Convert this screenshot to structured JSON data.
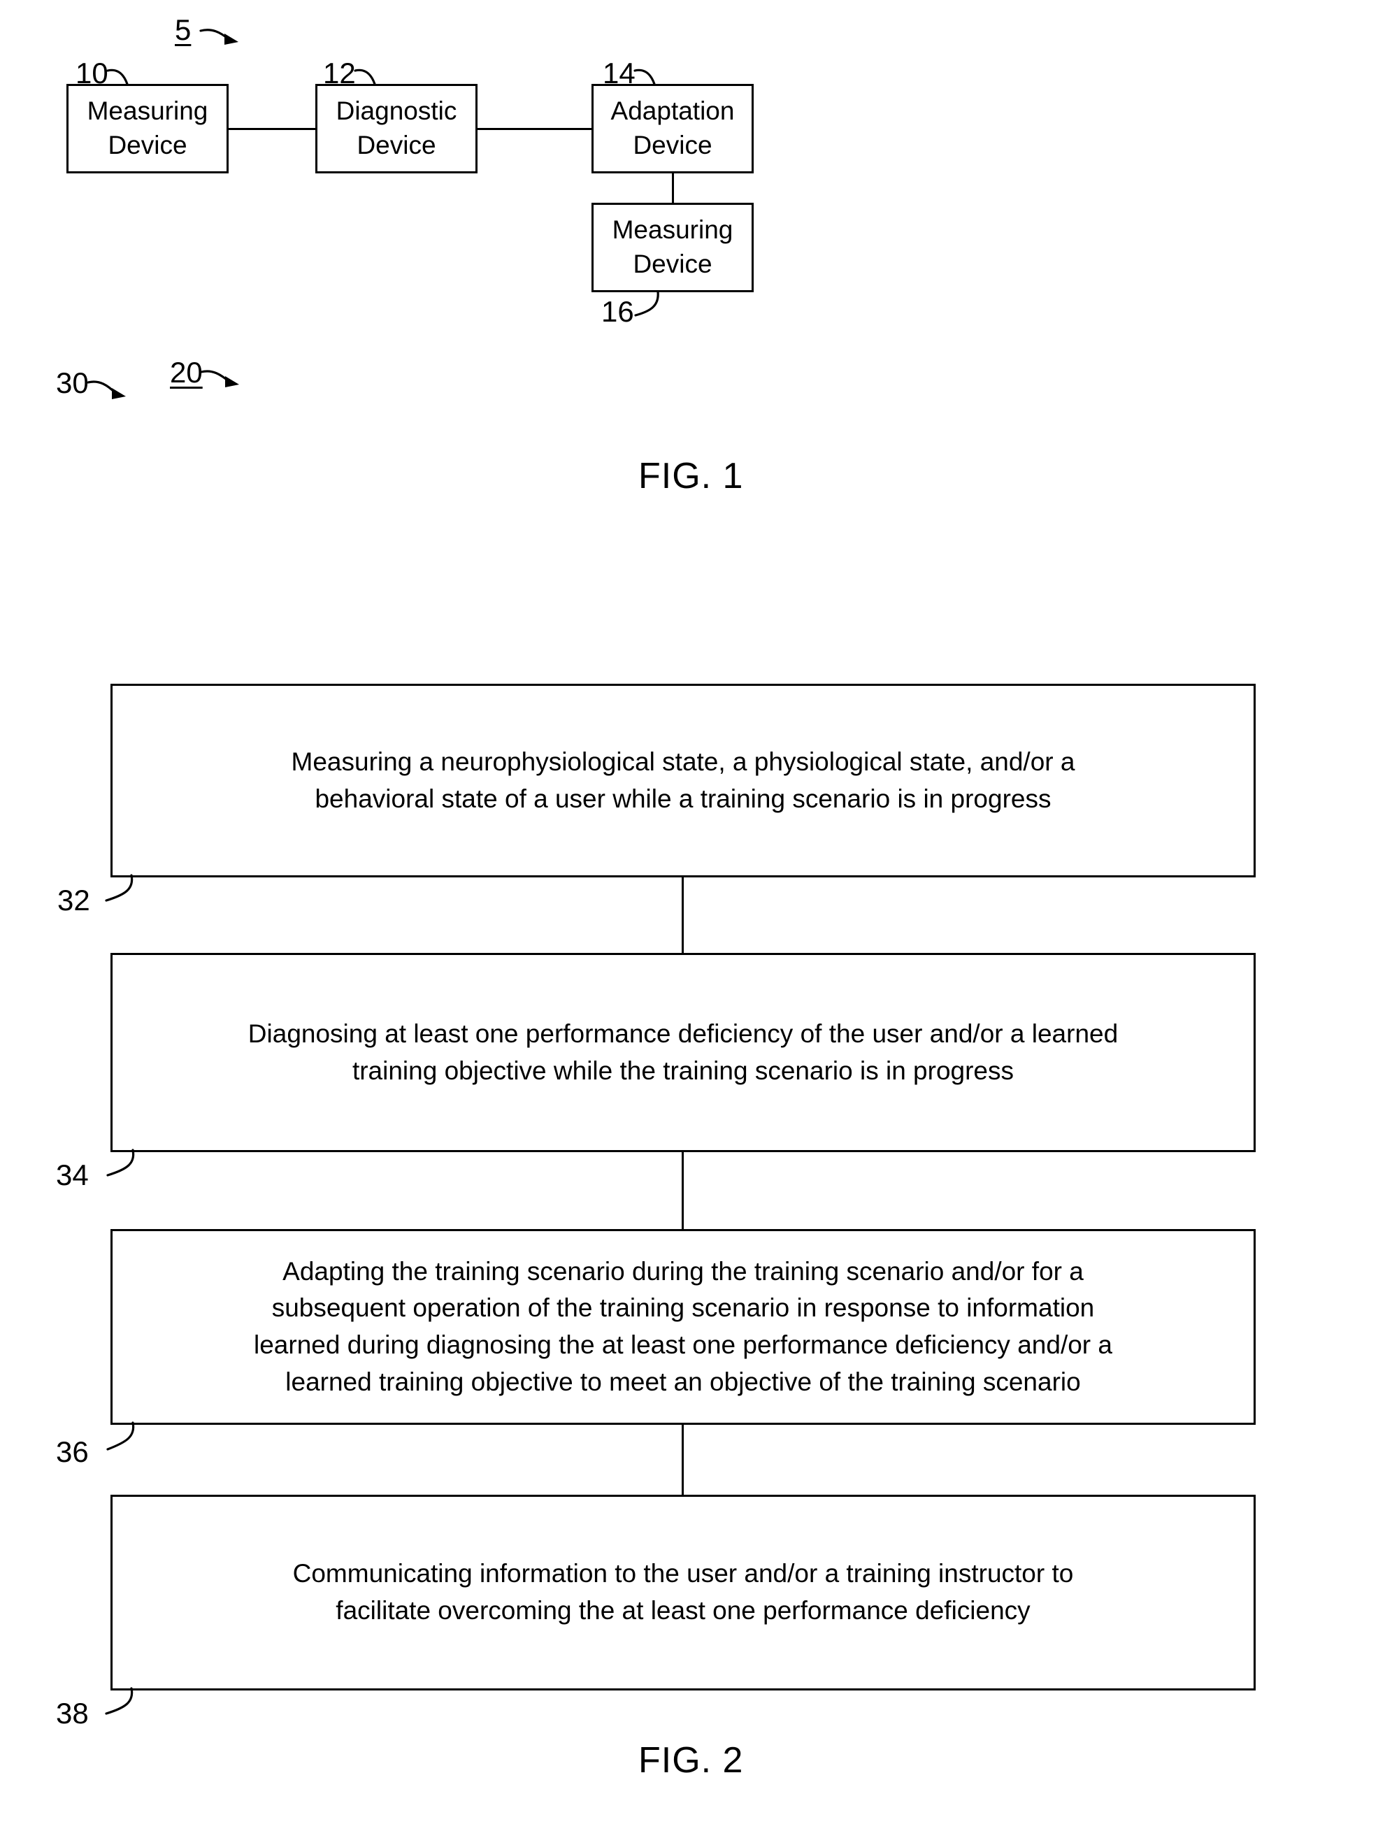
{
  "document": {
    "type": "patent-drawing-sheet",
    "background_color": "#ffffff",
    "ink_color": "#000000"
  },
  "figure1": {
    "caption": "FIG. 1",
    "system_ref": "5",
    "blocks": [
      {
        "ref": "10",
        "line1": "Measuring",
        "line2": "Device"
      },
      {
        "ref": "12",
        "line1": "Diagnostic",
        "line2": "Device"
      },
      {
        "ref": "14",
        "line1": "Adaptation",
        "line2": "Device"
      },
      {
        "ref": "16",
        "line1": "Measuring",
        "line2": "Device"
      }
    ]
  },
  "figure2": {
    "caption": "FIG. 2",
    "method_ref": "20",
    "flow_ref": "30",
    "steps": [
      {
        "ref": "32",
        "lines": [
          "Measuring a neurophysiological state, a physiological state, and/or a",
          "behavioral state of a user while a training scenario is in progress"
        ]
      },
      {
        "ref": "34",
        "lines": [
          "Diagnosing at least one performance deficiency of the user and/or a learned",
          "training objective while the training scenario is in progress"
        ]
      },
      {
        "ref": "36",
        "lines": [
          "Adapting the training scenario during the training scenario and/or for a",
          "subsequent operation of the training scenario in response to information",
          "learned during diagnosing the at least one performance deficiency and/or a",
          "learned training objective to meet an objective of the training scenario"
        ]
      },
      {
        "ref": "38",
        "lines": [
          "Communicating information to the user and/or a training instructor to",
          "facilitate overcoming the at least one performance deficiency"
        ]
      }
    ]
  }
}
